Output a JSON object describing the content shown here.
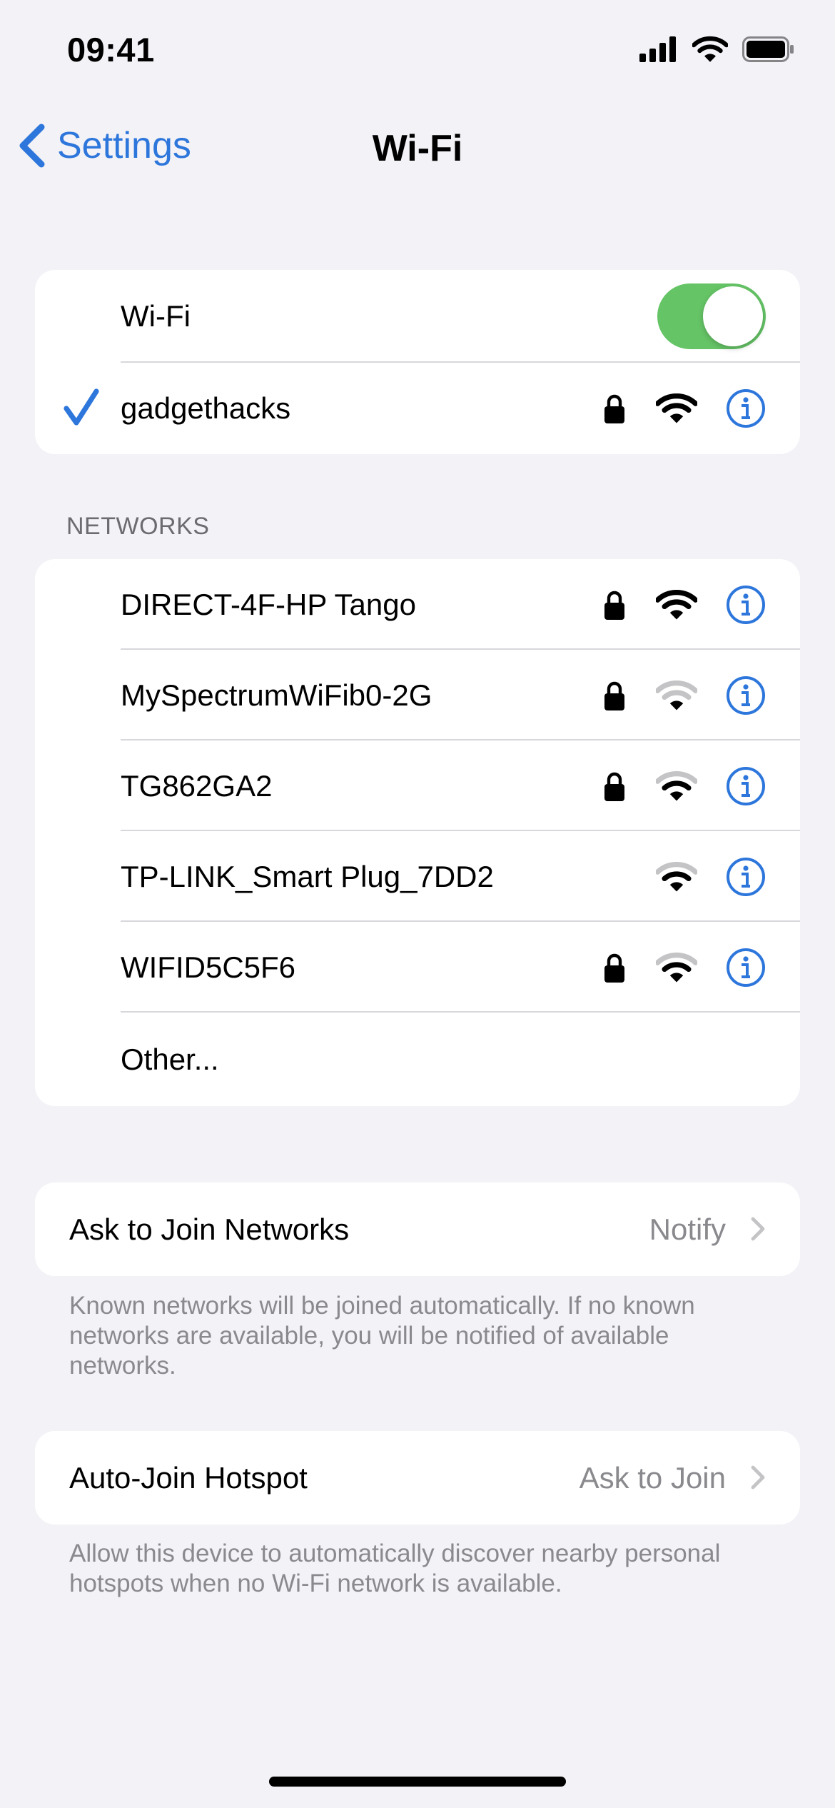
{
  "status_bar": {
    "time": "09:41",
    "icons": [
      "cellular-signal-icon",
      "wifi-icon",
      "battery-icon"
    ]
  },
  "nav": {
    "back_label": "Settings",
    "title": "Wi-Fi"
  },
  "wifi": {
    "label": "Wi-Fi",
    "enabled": true,
    "connected_network": {
      "name": "gadgethacks",
      "secured": true,
      "signal": "full"
    }
  },
  "networks": {
    "header": "NETWORKS",
    "items": [
      {
        "name": "DIRECT-4F-HP Tango",
        "secured": true,
        "signal": "full"
      },
      {
        "name": "MySpectrumWiFib0-2G",
        "secured": true,
        "signal": "medium"
      },
      {
        "name": "TG862GA2",
        "secured": true,
        "signal": "strong"
      },
      {
        "name": "TP-LINK_Smart Plug_7DD2",
        "secured": false,
        "signal": "strong"
      },
      {
        "name": "WIFID5C5F6",
        "secured": true,
        "signal": "strong"
      }
    ],
    "other_label": "Other..."
  },
  "ask_to_join": {
    "label": "Ask to Join Networks",
    "value": "Notify",
    "footnote": "Known networks will be joined automatically. If no known networks are available, you will be notified of available networks."
  },
  "auto_join_hotspot": {
    "label": "Auto-Join Hotspot",
    "value": "Ask to Join",
    "footnote": "Allow this device to automatically discover nearby personal hotspots when no Wi-Fi network is available."
  },
  "colors": {
    "accent": "#2d76db",
    "toggle_on": "#65c466",
    "background": "#f2f2f7",
    "secondary_text": "#8a8a8e"
  }
}
